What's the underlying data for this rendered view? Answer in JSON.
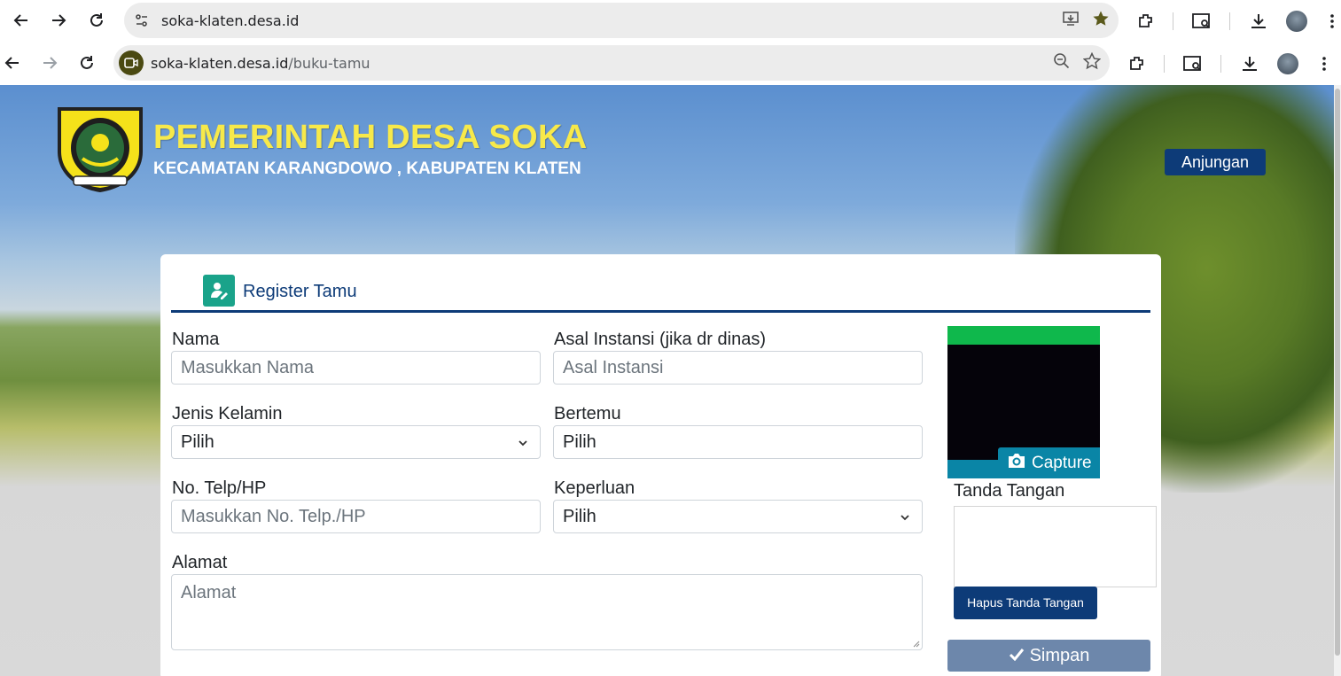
{
  "browser": {
    "row1": {
      "url_host": "soka-klaten.desa.id",
      "url_path": ""
    },
    "row2": {
      "url_host": "soka-klaten.desa.id",
      "url_path": "/buku-tamu"
    }
  },
  "header": {
    "title": "PEMERINTAH DESA SOKA",
    "subtitle": "KECAMATAN KARANGDOWO , KABUPATEN KLATEN",
    "anjungan_label": "Anjungan"
  },
  "form": {
    "heading": "Register Tamu",
    "nama": {
      "label": "Nama",
      "placeholder": "Masukkan Nama"
    },
    "asal_instansi": {
      "label": "Asal Instansi (jika dr dinas)",
      "placeholder": "Asal Instansi"
    },
    "jenis_kelamin": {
      "label": "Jenis Kelamin",
      "value": "Pilih"
    },
    "bertemu": {
      "label": "Bertemu",
      "value": "Pilih"
    },
    "telp": {
      "label": "No. Telp/HP",
      "placeholder": "Masukkan No. Telp./HP"
    },
    "keperluan": {
      "label": "Keperluan",
      "value": "Pilih"
    },
    "alamat": {
      "label": "Alamat",
      "placeholder": "Alamat"
    },
    "capture_label": "Capture",
    "tanda_tangan_label": "Tanda Tangan",
    "hapus_label": "Hapus Tanda Tangan",
    "simpan_label": "Simpan"
  },
  "colors": {
    "accent": "#0d3b78",
    "title_yellow": "#f7e94a",
    "capture_teal": "#0a85a6",
    "camera_green": "#0fb84c"
  }
}
